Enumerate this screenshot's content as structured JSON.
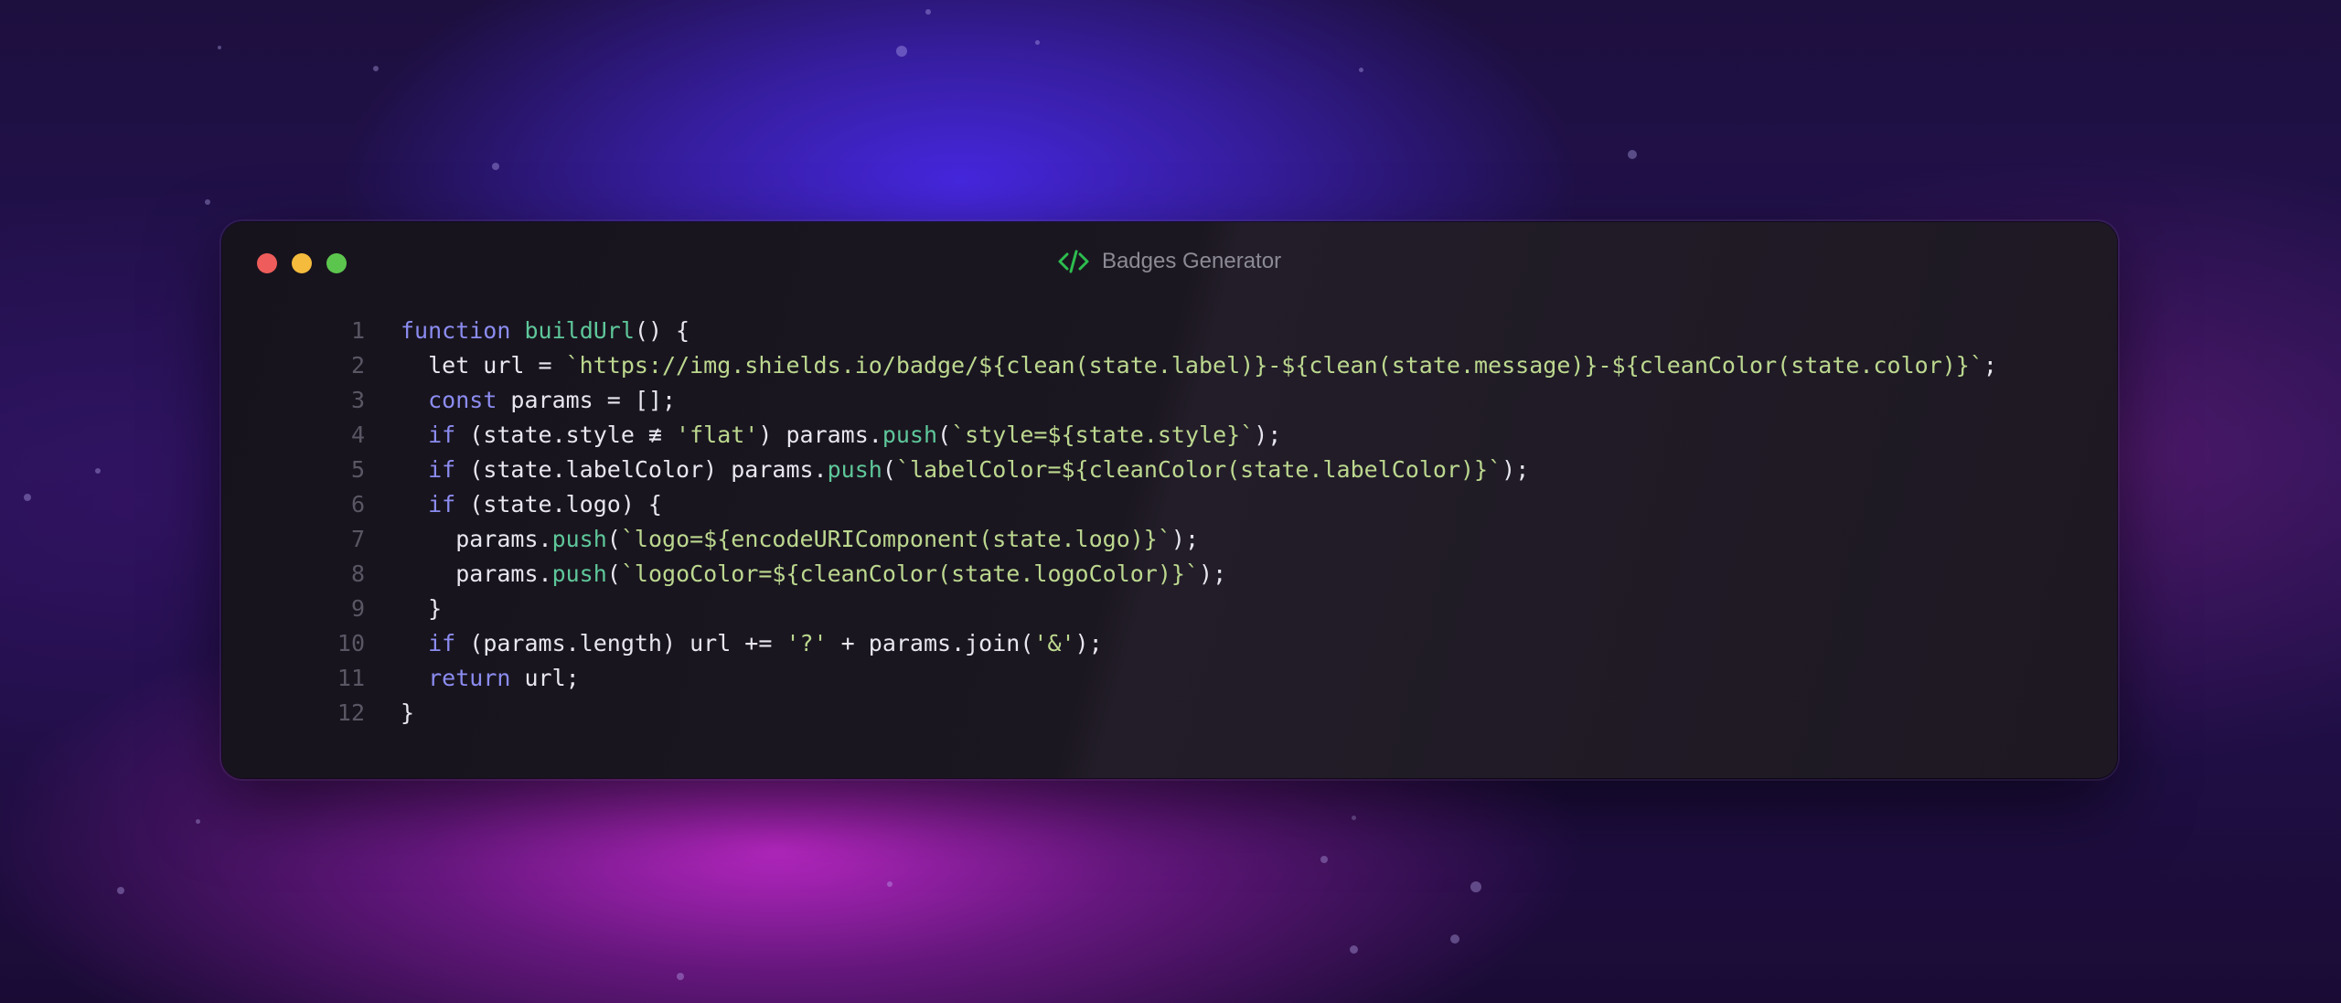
{
  "window": {
    "title": "Badges Generator",
    "title_icon": "code-icon",
    "controls": [
      "close",
      "minimize",
      "maximize"
    ]
  },
  "colors": {
    "keyword": "#8b8cf0",
    "function": "#5ec79a",
    "string": "#bcd88f",
    "plain": "#e8e6ef",
    "line_number": "#5a5663",
    "icon": "#2dbd4e"
  },
  "code": {
    "lines": [
      {
        "n": "1",
        "tokens": [
          {
            "t": "function",
            "c": "kw"
          },
          {
            "t": " ",
            "c": "pl"
          },
          {
            "t": "buildUrl",
            "c": "fn"
          },
          {
            "t": "() {",
            "c": "pl"
          }
        ]
      },
      {
        "n": "2",
        "tokens": [
          {
            "t": "  let url = ",
            "c": "pl"
          },
          {
            "t": "`https://img.shields.io/badge/${clean(state.label)}-${clean(state.message)}-${cleanColor(state.color)}`",
            "c": "str"
          },
          {
            "t": ";",
            "c": "pl"
          }
        ]
      },
      {
        "n": "3",
        "tokens": [
          {
            "t": "  ",
            "c": "pl"
          },
          {
            "t": "const",
            "c": "kw"
          },
          {
            "t": " params = [];",
            "c": "pl"
          }
        ]
      },
      {
        "n": "4",
        "tokens": [
          {
            "t": "  ",
            "c": "pl"
          },
          {
            "t": "if",
            "c": "kw"
          },
          {
            "t": " (state.style ≢ ",
            "c": "pl"
          },
          {
            "t": "'flat'",
            "c": "str"
          },
          {
            "t": ") params.",
            "c": "pl"
          },
          {
            "t": "push",
            "c": "fn"
          },
          {
            "t": "(",
            "c": "pl"
          },
          {
            "t": "`style=${state.style}`",
            "c": "str"
          },
          {
            "t": ");",
            "c": "pl"
          }
        ]
      },
      {
        "n": "5",
        "tokens": [
          {
            "t": "  ",
            "c": "pl"
          },
          {
            "t": "if",
            "c": "kw"
          },
          {
            "t": " (state.labelColor) params.",
            "c": "pl"
          },
          {
            "t": "push",
            "c": "fn"
          },
          {
            "t": "(",
            "c": "pl"
          },
          {
            "t": "`labelColor=${cleanColor(state.labelColor)}`",
            "c": "str"
          },
          {
            "t": ");",
            "c": "pl"
          }
        ]
      },
      {
        "n": "6",
        "tokens": [
          {
            "t": "  ",
            "c": "pl"
          },
          {
            "t": "if",
            "c": "kw"
          },
          {
            "t": " (state.logo) {",
            "c": "pl"
          }
        ]
      },
      {
        "n": "7",
        "tokens": [
          {
            "t": "    params.",
            "c": "pl"
          },
          {
            "t": "push",
            "c": "fn"
          },
          {
            "t": "(",
            "c": "pl"
          },
          {
            "t": "`logo=${encodeURIComponent(state.logo)}`",
            "c": "str"
          },
          {
            "t": ");",
            "c": "pl"
          }
        ]
      },
      {
        "n": "8",
        "tokens": [
          {
            "t": "    params.",
            "c": "pl"
          },
          {
            "t": "push",
            "c": "fn"
          },
          {
            "t": "(",
            "c": "pl"
          },
          {
            "t": "`logoColor=${cleanColor(state.logoColor)}`",
            "c": "str"
          },
          {
            "t": ");",
            "c": "pl"
          }
        ]
      },
      {
        "n": "9",
        "tokens": [
          {
            "t": "  }",
            "c": "pl"
          }
        ]
      },
      {
        "n": "10",
        "tokens": [
          {
            "t": "  ",
            "c": "pl"
          },
          {
            "t": "if",
            "c": "kw"
          },
          {
            "t": " (params.length) url += ",
            "c": "pl"
          },
          {
            "t": "'?'",
            "c": "str"
          },
          {
            "t": " + params.join(",
            "c": "pl"
          },
          {
            "t": "'&'",
            "c": "str"
          },
          {
            "t": ");",
            "c": "pl"
          }
        ]
      },
      {
        "n": "11",
        "tokens": [
          {
            "t": "  ",
            "c": "pl"
          },
          {
            "t": "return",
            "c": "kw"
          },
          {
            "t": " url;",
            "c": "pl"
          }
        ]
      },
      {
        "n": "12",
        "tokens": [
          {
            "t": "}",
            "c": "pl"
          }
        ]
      }
    ]
  }
}
